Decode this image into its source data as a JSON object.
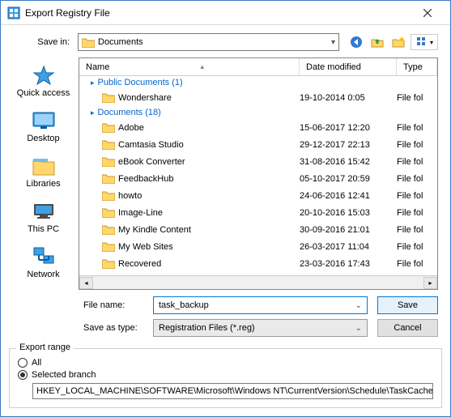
{
  "window": {
    "title": "Export Registry File"
  },
  "top": {
    "save_in_label": "Save in:",
    "save_in_value": "Documents",
    "toolbar": {
      "back": "back",
      "up": "up",
      "newfolder": "new-folder",
      "views": "views"
    }
  },
  "places": [
    {
      "key": "quick-access",
      "label": "Quick access"
    },
    {
      "key": "desktop",
      "label": "Desktop"
    },
    {
      "key": "libraries",
      "label": "Libraries"
    },
    {
      "key": "this-pc",
      "label": "This PC"
    },
    {
      "key": "network",
      "label": "Network"
    }
  ],
  "columns": {
    "name": "Name",
    "date": "Date modified",
    "type": "Type"
  },
  "groups": [
    {
      "header": "Public Documents (1)",
      "items": [
        {
          "name": "Wondershare",
          "date": "19-10-2014 0:05",
          "type": "File fol"
        }
      ]
    },
    {
      "header": "Documents (18)",
      "items": [
        {
          "name": "Adobe",
          "date": "15-06-2017 12:20",
          "type": "File fol"
        },
        {
          "name": "Camtasia Studio",
          "date": "29-12-2017 22:13",
          "type": "File fol"
        },
        {
          "name": "eBook Converter",
          "date": "31-08-2016 15:42",
          "type": "File fol"
        },
        {
          "name": "FeedbackHub",
          "date": "05-10-2017 20:59",
          "type": "File fol"
        },
        {
          "name": "howto",
          "date": "24-06-2016 12:41",
          "type": "File fol"
        },
        {
          "name": "Image-Line",
          "date": "20-10-2016 15:03",
          "type": "File fol"
        },
        {
          "name": "My Kindle Content",
          "date": "30-09-2016 21:01",
          "type": "File fol"
        },
        {
          "name": "My Web Sites",
          "date": "26-03-2017 11:04",
          "type": "File fol"
        },
        {
          "name": "Recovered",
          "date": "23-03-2016 17:43",
          "type": "File fol"
        }
      ]
    }
  ],
  "bottom": {
    "file_name_label": "File name:",
    "file_name_value": "task_backup",
    "save_type_label": "Save as type:",
    "save_type_value": "Registration Files (*.reg)",
    "save_btn": "Save",
    "cancel_btn": "Cancel"
  },
  "export": {
    "legend": "Export range",
    "all": "All",
    "selected": "Selected branch",
    "branch_path": "HKEY_LOCAL_MACHINE\\SOFTWARE\\Microsoft\\Windows NT\\CurrentVersion\\Schedule\\TaskCache"
  }
}
